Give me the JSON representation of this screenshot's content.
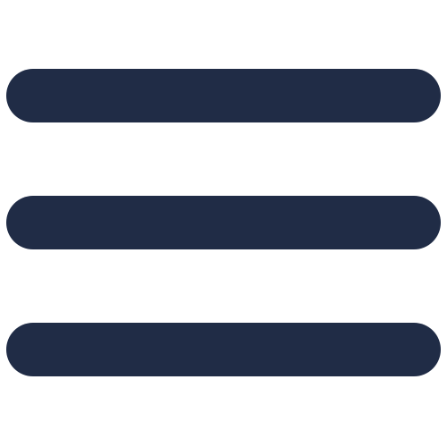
{
  "icon": {
    "semantic_name": "hamburger-menu-icon",
    "color": "#202C46",
    "background": "#FFFFFF"
  }
}
